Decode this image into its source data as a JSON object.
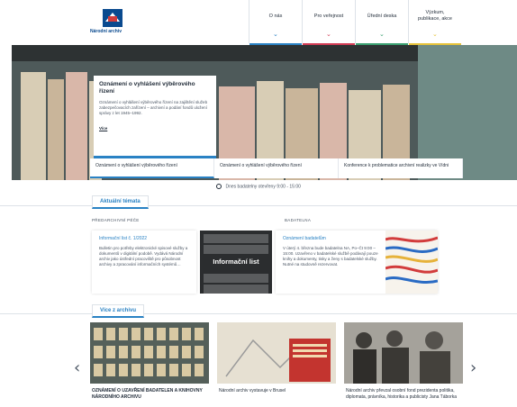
{
  "header": {
    "logo_text": "Národní archiv",
    "nav": [
      {
        "label": "O nás",
        "color": "#2a82c4"
      },
      {
        "label": "Pro veřejnost",
        "color": "#d23c55"
      },
      {
        "label": "Úřední deska",
        "color": "#3aa071"
      },
      {
        "label": "Výzkum, publikace, akce",
        "color": "#e6c23a"
      }
    ]
  },
  "hero": {
    "card": {
      "title": "Oznámení o vyhlášení výběrového řízení",
      "body": "Oznámení o vyhlášení výběrového řízení na zajištění služeb zabezpečovacích zařízení – archivní a podání fondů uložení správy z let 1945–1992.",
      "more": "Více"
    },
    "tabs": [
      {
        "label": "Oznámení o vyhlášení výběrového řízení"
      },
      {
        "label": "Oznámení o vyhlášení výběrového řízení"
      },
      {
        "label": "Konference k problematice archivní realizky ve Vídni"
      }
    ]
  },
  "hours": "Dnes badatelny otevřeny 9:00 - 15:00",
  "current": {
    "section_title": "Aktuální témata",
    "left_label": "PŘEDARCHIVNÍ PÉČE",
    "right_label": "BADATELNA",
    "news1": {
      "title": "Informační list č. 1/2022",
      "body": "Bulletin pro potřeby elektronické spisové služby a dokumentů v digitální podobě. Vydává Národní archiv jako ústřední pracoviště pro působnost archivy a zpracování informačních systémů…"
    },
    "info_caption": "Informační list",
    "news2": {
      "title": "Oznámení badatelům",
      "body": "V úterý 4. března bude badatelna NA, Po–Čt 9:00 – 15:00. Uzavřeno v badatelské službě podávají pouze knihy a dokumenty, tisky a ženy s badatelské služby. Nutné na studovně rezervovat."
    }
  },
  "more": {
    "section_title": "Více z archivu",
    "cards": [
      {
        "title": "OZNÁMENÍ O UZAVŘENÍ BADATELEN A KNIHOVNY NÁRODNÍHO ARCHIVU"
      },
      {
        "title": "Národní archiv vystavuje v Brusel"
      },
      {
        "title": "Národní archiv převzal osobní fond prezidenta politika, diplomata, právníka, historika a publicisty Jana Táborka"
      }
    ],
    "prev": "‹",
    "next": "›"
  }
}
